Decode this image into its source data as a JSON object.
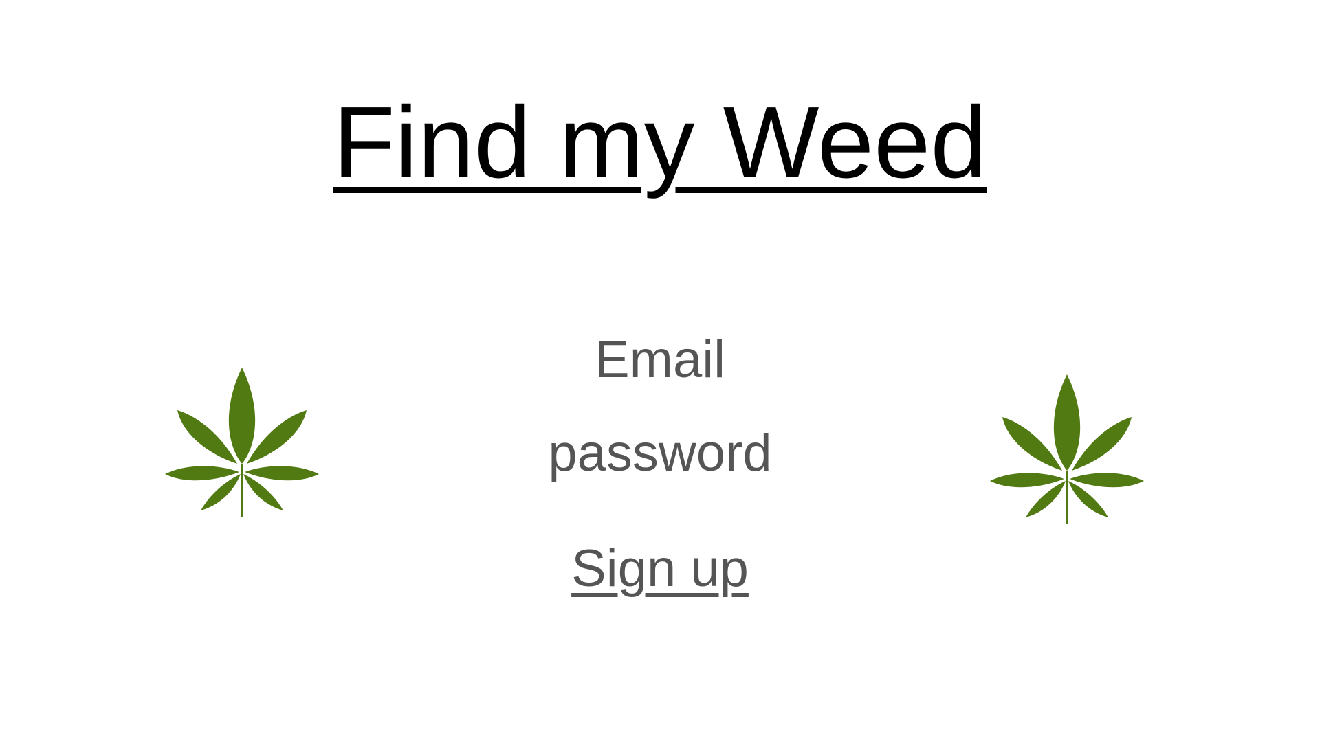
{
  "page": {
    "title": "Find my Weed"
  },
  "form": {
    "email_label": "Email",
    "password_label": "password",
    "signup_link": "Sign up"
  },
  "icons": {
    "left": "cannabis-leaf-icon",
    "right": "cannabis-leaf-icon"
  },
  "colors": {
    "leaf": "#527a12",
    "text_primary": "#000000",
    "text_secondary": "#555555",
    "background": "#ffffff"
  }
}
